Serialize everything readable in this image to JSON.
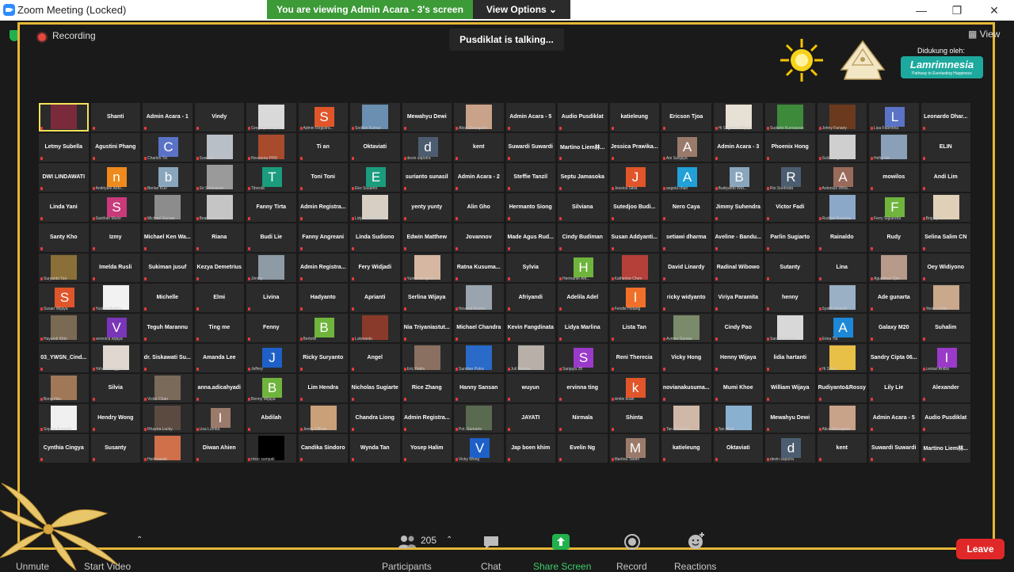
{
  "window": {
    "title": "Zoom Meeting (Locked)",
    "minimize": "—",
    "restore": "❐",
    "close": "✕"
  },
  "banner": {
    "viewing": "You are viewing Admin Acara - 3's screen",
    "view_options": "View Options ⌄"
  },
  "meeting": {
    "recording": "Recording",
    "talking": "Pusdiklat is talking...",
    "view": "View"
  },
  "sponsor": {
    "text": "Didukung oleh:",
    "name": "Lamrimnesia",
    "tagline": "Pathway to Everlasting Happiness"
  },
  "colors": {
    "frame": "#e5b637",
    "banner_green": "#3c9a37",
    "share_green": "#23b14d",
    "leave_red": "#e02828"
  },
  "tiles": [
    {
      "type": "video",
      "caption": "",
      "bg": "#7a2b3b",
      "active": true
    },
    {
      "type": "name",
      "name": "Shanti"
    },
    {
      "type": "name",
      "name": "Admin Acara - 1"
    },
    {
      "type": "name",
      "name": "Vindy"
    },
    {
      "type": "video",
      "caption": "Gregory Wuzpo",
      "bg": "#d9d9d9"
    },
    {
      "type": "avatar",
      "letter": "S",
      "color": "#e0552a",
      "caption": "Admin Registra..."
    },
    {
      "type": "video",
      "caption": "Sodikin Kumar",
      "bg": "#6a8fb0"
    },
    {
      "type": "name",
      "name": "Mewahyu Dewi"
    },
    {
      "type": "video",
      "caption": "Alice Ekasaputri",
      "bg": "#c9a28a"
    },
    {
      "type": "name",
      "name": "Admin Acara - 5"
    },
    {
      "type": "name",
      "name": "Audio Pusdiklat"
    },
    {
      "type": "name",
      "name": "katieleung"
    },
    {
      "type": "name",
      "name": "Ericson Tjoa"
    },
    {
      "type": "video",
      "caption": "Hi Sugiarto Witjaya",
      "bg": "#e7e0d4"
    },
    {
      "type": "video",
      "caption": "Sudarto Kurniawan",
      "bg": "#3d8a3a"
    },
    {
      "type": "video",
      "caption": "Johny Fanany",
      "bg": "#6b3a1e"
    },
    {
      "type": "avatar",
      "letter": "L",
      "color": "#5a73c7",
      "caption": "Lisa Falentina"
    },
    {
      "type": "name",
      "name": "Leonardo Dhar..."
    },
    {
      "type": "name",
      "name": "Letmy Subella"
    },
    {
      "type": "name",
      "name": "Agustini Phang"
    },
    {
      "type": "avatar",
      "letter": "C",
      "color": "#5a73c7",
      "caption": "Charles Tio"
    },
    {
      "type": "video",
      "caption": "Suwardi",
      "bg": "#b9bfc7"
    },
    {
      "type": "video",
      "caption": "Novianna PHD",
      "bg": "#a84a2c"
    },
    {
      "type": "name",
      "name": "Ti an"
    },
    {
      "type": "name",
      "name": "Oktaviati"
    },
    {
      "type": "avatar",
      "letter": "d",
      "color": "#4c5d70",
      "caption": "devin saputra"
    },
    {
      "type": "name",
      "name": "kent"
    },
    {
      "type": "name",
      "name": "Suwardi Suwardi"
    },
    {
      "type": "name",
      "name": "Martino Liem林..."
    },
    {
      "type": "name",
      "name": "Jessica Prawika..."
    },
    {
      "type": "avatar",
      "letter": "A",
      "color": "#9a7a6a",
      "caption": "Ani Sanjaya"
    },
    {
      "type": "name",
      "name": "Admin Acara - 3"
    },
    {
      "type": "name",
      "name": "Phoenix Hong"
    },
    {
      "type": "video",
      "caption": "Sulistio Ig. Pr...",
      "bg": "#cfcfcf"
    },
    {
      "type": "video",
      "caption": "Hefry Lie",
      "bg": "#8aa0b8"
    },
    {
      "type": "name",
      "name": "ELIN"
    },
    {
      "type": "name",
      "name": "DWI LINDAWATI"
    },
    {
      "type": "avatar",
      "letter": "n",
      "color": "#ef8a1d",
      "caption": "Andriyani Anto..."
    },
    {
      "type": "avatar",
      "letter": "b",
      "color": "#8aa6bd",
      "caption": "Berlan Kuo"
    },
    {
      "type": "video",
      "caption": "Sri Srinivasan",
      "bg": "#9a9a9a"
    },
    {
      "type": "avatar",
      "letter": "T",
      "color": "#1a9c7d",
      "caption": "Tiborda"
    },
    {
      "type": "name",
      "name": "Toni Toni"
    },
    {
      "type": "avatar",
      "letter": "E",
      "color": "#1a9c7d",
      "caption": "Eko Susanto"
    },
    {
      "type": "name",
      "name": "surianto sunasil"
    },
    {
      "type": "name",
      "name": "Admin Acara - 2"
    },
    {
      "type": "name",
      "name": "Steffie Tanzil"
    },
    {
      "type": "name",
      "name": "Septu Jamasoka"
    },
    {
      "type": "avatar",
      "letter": "J",
      "color": "#e0552a",
      "caption": "Jessica Silva"
    },
    {
      "type": "avatar",
      "letter": "A",
      "color": "#22a0d8",
      "caption": "angela chan"
    },
    {
      "type": "avatar",
      "letter": "B",
      "color": "#8aa6bd",
      "caption": "Budiyanto Wid..."
    },
    {
      "type": "avatar",
      "letter": "R",
      "color": "#4c5d70",
      "caption": "Rio Soebrata"
    },
    {
      "type": "avatar",
      "letter": "A",
      "color": "#9a6a5a",
      "caption": "Antonius Witta..."
    },
    {
      "type": "name",
      "name": "mowilos"
    },
    {
      "type": "name",
      "name": "Andi Lim"
    },
    {
      "type": "name",
      "name": "Linda Yani"
    },
    {
      "type": "avatar",
      "letter": "S",
      "color": "#c83a7a",
      "caption": "Santhan Munir"
    },
    {
      "type": "video",
      "caption": "Michael Gunaw",
      "bg": "#8c8c8c"
    },
    {
      "type": "video",
      "caption": "Beatrice Lowu",
      "bg": "#c5c5c5"
    },
    {
      "type": "name",
      "name": "Fanny Tirta"
    },
    {
      "type": "name",
      "name": "Admin Registra..."
    },
    {
      "type": "video",
      "caption": "Lidya Kurniawan",
      "bg": "#d7cfc4"
    },
    {
      "type": "name",
      "name": "yenty yunty"
    },
    {
      "type": "name",
      "name": "Alin Gho"
    },
    {
      "type": "name",
      "name": "Hermanto Siong"
    },
    {
      "type": "name",
      "name": "Silviana"
    },
    {
      "type": "name",
      "name": "Sutedjoo Budi..."
    },
    {
      "type": "name",
      "name": "Nero Caya"
    },
    {
      "type": "name",
      "name": "Jimmy Suhendra"
    },
    {
      "type": "name",
      "name": "Victor Fadi"
    },
    {
      "type": "video",
      "caption": "Rudijan Kusuma",
      "bg": "#8ca8c8"
    },
    {
      "type": "avatar",
      "letter": "F",
      "color": "#6fb43c",
      "caption": "Ferry Sigiandra"
    },
    {
      "type": "video",
      "caption": "Brig Tjie",
      "bg": "#e0d0b8"
    },
    {
      "type": "name",
      "name": "Santy Kho"
    },
    {
      "type": "name",
      "name": "Izmy"
    },
    {
      "type": "name",
      "name": "Michael Ken Wa..."
    },
    {
      "type": "name",
      "name": "Riana"
    },
    {
      "type": "name",
      "name": "Budi Lie"
    },
    {
      "type": "name",
      "name": "Fanny Angreani"
    },
    {
      "type": "name",
      "name": "Linda Sudiono"
    },
    {
      "type": "name",
      "name": "Edwin Matthew"
    },
    {
      "type": "name",
      "name": "Jovannov"
    },
    {
      "type": "name",
      "name": "Made Agus Rud..."
    },
    {
      "type": "name",
      "name": "Cindy Budiman"
    },
    {
      "type": "name",
      "name": "Susan Addyanti..."
    },
    {
      "type": "name",
      "name": "setiawi dharma"
    },
    {
      "type": "name",
      "name": "Aveline - Bandu..."
    },
    {
      "type": "name",
      "name": "Parlin Sugiarto"
    },
    {
      "type": "name",
      "name": "Rainaldo"
    },
    {
      "type": "name",
      "name": "Rudy"
    },
    {
      "type": "name",
      "name": "Selina Salim CN"
    },
    {
      "type": "video",
      "caption": "Suryanto Tan",
      "bg": "#8a7038"
    },
    {
      "type": "name",
      "name": "Imelda Rusli"
    },
    {
      "type": "name",
      "name": "Sukiman jusuf"
    },
    {
      "type": "name",
      "name": "Kezya Demetrius"
    },
    {
      "type": "video",
      "caption": "Jimmy",
      "bg": "#8e9aa4"
    },
    {
      "type": "name",
      "name": "Admin Registra..."
    },
    {
      "type": "name",
      "name": "Fery Widjadi"
    },
    {
      "type": "video",
      "caption": "Yumin Taniyoto",
      "bg": "#d6b7a2"
    },
    {
      "type": "name",
      "name": "Ratna Kusuma..."
    },
    {
      "type": "name",
      "name": "Sylvia"
    },
    {
      "type": "avatar",
      "letter": "H",
      "color": "#6fb43c",
      "caption": "Hermanto Ant..."
    },
    {
      "type": "video",
      "caption": "Katherine Chen",
      "bg": "#b5403a"
    },
    {
      "type": "name",
      "name": "David Linardy"
    },
    {
      "type": "name",
      "name": "Radinal Wibowo"
    },
    {
      "type": "name",
      "name": "Sutanty"
    },
    {
      "type": "name",
      "name": "Lina"
    },
    {
      "type": "video",
      "caption": "Agustinus Tjan",
      "bg": "#b89a8a"
    },
    {
      "type": "name",
      "name": "Oey Widiyono"
    },
    {
      "type": "avatar",
      "letter": "S",
      "color": "#e0552a",
      "caption": "Susan Wijaya"
    },
    {
      "type": "video",
      "caption": "Yustina Budiha",
      "bg": "#f2f2f2"
    },
    {
      "type": "name",
      "name": "Michelle"
    },
    {
      "type": "name",
      "name": "Elmi"
    },
    {
      "type": "name",
      "name": "Livina"
    },
    {
      "type": "name",
      "name": "Hadyanto"
    },
    {
      "type": "name",
      "name": "Aprianti"
    },
    {
      "type": "name",
      "name": "Serlina Wijaya"
    },
    {
      "type": "video",
      "caption": "Novaria Kurnia",
      "bg": "#9aa4ae"
    },
    {
      "type": "name",
      "name": "Afriyandi"
    },
    {
      "type": "name",
      "name": "Adelila Adel"
    },
    {
      "type": "avatar",
      "letter": "l",
      "color": "#f0702a",
      "caption": "Fendie Hotang"
    },
    {
      "type": "name",
      "name": "ricky widyanto"
    },
    {
      "type": "name",
      "name": "Viriya Paramita"
    },
    {
      "type": "name",
      "name": "henny"
    },
    {
      "type": "video",
      "caption": "Syafril Isnandi",
      "bg": "#9ab0c4"
    },
    {
      "type": "name",
      "name": "Ade gunarta"
    },
    {
      "type": "video",
      "caption": "Yenie Lonan",
      "bg": "#c9a88c"
    },
    {
      "type": "video",
      "caption": "Hayandi Kitto",
      "bg": "#7a6a54"
    },
    {
      "type": "avatar",
      "letter": "V",
      "color": "#7a35b8",
      "caption": "veronica wijaya"
    },
    {
      "type": "name",
      "name": "Teguh Marannu"
    },
    {
      "type": "name",
      "name": "Ting me"
    },
    {
      "type": "name",
      "name": "Fenny"
    },
    {
      "type": "avatar",
      "letter": "B",
      "color": "#6fb43c",
      "caption": "Bertolik"
    },
    {
      "type": "video",
      "caption": "Lukmanto",
      "bg": "#8a3a2a"
    },
    {
      "type": "name",
      "name": "Nia Triyaniastut..."
    },
    {
      "type": "name",
      "name": "Michael Chandra"
    },
    {
      "type": "name",
      "name": "Kevin Fangdinata"
    },
    {
      "type": "name",
      "name": "Lidya Marlina"
    },
    {
      "type": "name",
      "name": "Lista Tan"
    },
    {
      "type": "video",
      "caption": "Aviniro Gunaw",
      "bg": "#7a8a6a"
    },
    {
      "type": "name",
      "name": "Cindy Pao"
    },
    {
      "type": "video",
      "caption": "Sandi Chandra",
      "bg": "#d8d8d8"
    },
    {
      "type": "avatar",
      "letter": "A",
      "color": "#1e88d8",
      "caption": "Erina Tia"
    },
    {
      "type": "name",
      "name": "Galaxy M20"
    },
    {
      "type": "name",
      "name": "Suhalim"
    },
    {
      "type": "name",
      "name": "03_YWSN_Cind..."
    },
    {
      "type": "video",
      "caption": "Yohana Anggrei",
      "bg": "#e0d8d0"
    },
    {
      "type": "name",
      "name": "dr. Siskawati Su..."
    },
    {
      "type": "name",
      "name": "Amanda Lee"
    },
    {
      "type": "avatar",
      "letter": "J",
      "color": "#1e60c8",
      "caption": "Jeffery"
    },
    {
      "type": "name",
      "name": "Ricky Suryanto"
    },
    {
      "type": "name",
      "name": "Angel"
    },
    {
      "type": "video",
      "caption": "Eric Halim",
      "bg": "#8a7060"
    },
    {
      "type": "video",
      "caption": "Sandian Putra",
      "bg": "#2a6ac8"
    },
    {
      "type": "video",
      "caption": "Juli Manian",
      "bg": "#b8b0a8"
    },
    {
      "type": "avatar",
      "letter": "S",
      "color": "#9a3ac8",
      "caption": "Sanjaya 28"
    },
    {
      "type": "name",
      "name": "Reni Therecia"
    },
    {
      "type": "name",
      "name": "Vicky Hong"
    },
    {
      "type": "name",
      "name": "Henny Wijaya"
    },
    {
      "type": "name",
      "name": "lidia hartanti"
    },
    {
      "type": "video",
      "caption": "Hi Sindi",
      "bg": "#e8c048"
    },
    {
      "type": "name",
      "name": "Sandry Cipta 06..."
    },
    {
      "type": "avatar",
      "letter": "I",
      "color": "#9a3ac8",
      "caption": "Lestari Andra"
    },
    {
      "type": "video",
      "caption": "Bong Hao",
      "bg": "#a07858"
    },
    {
      "type": "name",
      "name": "Silvia"
    },
    {
      "type": "video",
      "caption": "Victor Chan",
      "bg": "#7a6a5a"
    },
    {
      "type": "name",
      "name": "anna.adicahyadi"
    },
    {
      "type": "avatar",
      "letter": "B",
      "color": "#6fb43c",
      "caption": "Benny Wijaya"
    },
    {
      "type": "name",
      "name": "Lim Hendra"
    },
    {
      "type": "name",
      "name": "Nicholas Sugiarte"
    },
    {
      "type": "name",
      "name": "Rice Zhang"
    },
    {
      "type": "name",
      "name": "Hanny Sansan"
    },
    {
      "type": "name",
      "name": "wuyun"
    },
    {
      "type": "name",
      "name": "ervinna ting"
    },
    {
      "type": "avatar",
      "letter": "k",
      "color": "#e0552a",
      "caption": "kimlie kuan"
    },
    {
      "type": "name",
      "name": "novianakusuma..."
    },
    {
      "type": "name",
      "name": "Mumi Khoe"
    },
    {
      "type": "name",
      "name": "William Wijaya"
    },
    {
      "type": "name",
      "name": "Rudiyanto&Rossy"
    },
    {
      "type": "name",
      "name": "Lily Lie"
    },
    {
      "type": "name",
      "name": "Alexander"
    },
    {
      "type": "video",
      "caption": "Sophia Kusnadi",
      "bg": "#f0f0f0"
    },
    {
      "type": "name",
      "name": "Hendry Wong"
    },
    {
      "type": "video",
      "caption": "Rhayna Lucky",
      "bg": "#5a4a40"
    },
    {
      "type": "avatar",
      "letter": "I",
      "color": "#9a7a6a",
      "caption": "Lisa Lumba"
    },
    {
      "type": "name",
      "name": "Abdilah"
    },
    {
      "type": "video",
      "caption": "Jenny Elfinda",
      "bg": "#c9a078"
    },
    {
      "type": "name",
      "name": "Chandra Liong"
    },
    {
      "type": "name",
      "name": "Admin Registra..."
    },
    {
      "type": "video",
      "caption": "Pet. Sumarto",
      "bg": "#5a6a50"
    },
    {
      "type": "name",
      "name": "JAYATI"
    },
    {
      "type": "name",
      "name": "Nirmala"
    },
    {
      "type": "name",
      "name": "Shinta"
    },
    {
      "type": "video",
      "caption": "Tan Ikhwanto",
      "bg": "#d0b8a8"
    },
    {
      "type": "video",
      "caption": "Tan Hadi",
      "bg": "#8ab0d0"
    },
    {
      "type": "name",
      "name": "Mewahyu Dewi"
    },
    {
      "type": "video",
      "caption": "Alice Ekasaputri",
      "bg": "#c9a28a"
    },
    {
      "type": "name",
      "name": "Admin Acara - 5"
    },
    {
      "type": "name",
      "name": "Audio Pusdiklat"
    },
    {
      "type": "name",
      "name": "Cynthia Cingya"
    },
    {
      "type": "name",
      "name": "Susanty"
    },
    {
      "type": "video",
      "caption": "Herlinawati",
      "bg": "#d0704a"
    },
    {
      "type": "name",
      "name": "Diwan Ahien"
    },
    {
      "type": "video",
      "caption": "ririco sumpali",
      "bg": "#000000"
    },
    {
      "type": "name",
      "name": "Candika Sindoro"
    },
    {
      "type": "name",
      "name": "Wynda Tan"
    },
    {
      "type": "name",
      "name": "Yosep Halim"
    },
    {
      "type": "avatar",
      "letter": "V",
      "color": "#1e60c8",
      "caption": "Vicky Wong"
    },
    {
      "type": "name",
      "name": "Jap boen khim"
    },
    {
      "type": "name",
      "name": "Evelin Ng"
    },
    {
      "type": "avatar",
      "letter": "M",
      "color": "#9a7a6a",
      "caption": "Martina Tandri"
    },
    {
      "type": "name",
      "name": "katieleung"
    },
    {
      "type": "name",
      "name": "Oktaviati"
    },
    {
      "type": "avatar",
      "letter": "d",
      "color": "#4c5d70",
      "caption": "devin saputra"
    },
    {
      "type": "name",
      "name": "kent"
    },
    {
      "type": "name",
      "name": "Suwardi Suwardi"
    },
    {
      "type": "name",
      "name": "Martino Liem林..."
    }
  ],
  "toolbar": {
    "unmute": "Unmute",
    "start_video": "Start Video",
    "participants": "Participants",
    "participants_count": "205",
    "chat": "Chat",
    "share_screen": "Share Screen",
    "record": "Record",
    "reactions": "Reactions",
    "leave": "Leave"
  }
}
